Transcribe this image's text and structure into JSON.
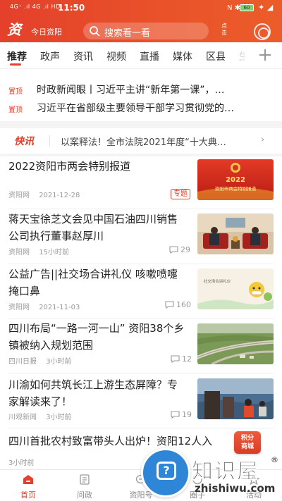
{
  "status_bar": {
    "signal": "4G⁺ .ıl 4G .ıl HD",
    "time": "11:50",
    "battery": "60",
    "status_icons": "N ✱ ⏰",
    "extra": "✦ ◢"
  },
  "header": {
    "logo_glyph": "资",
    "app_title": "今日资阳",
    "search_placeholder": "搜索看一看",
    "points_label_top": "点",
    "points_label_bottom": "击",
    "avatar_icon": "user-avatar-icon"
  },
  "tabs": {
    "items": [
      "推荐",
      "政声",
      "资讯",
      "视频",
      "直播",
      "媒体",
      "区县",
      "生"
    ],
    "active": "推荐",
    "add_icon": "plus-icon"
  },
  "pinned": [
    {
      "badge": "置顶",
      "title": "时政新闻眼丨习近平主讲“新年第一课”，…"
    },
    {
      "badge": "置顶",
      "title": "习近平在省部级主要领导干部学习贯彻党的…"
    }
  ],
  "flash": {
    "badge": "快讯",
    "text": "以案释法！全市法院2021年度“十大典…",
    "arrow": "›"
  },
  "news": [
    {
      "title": "2022资阳市两会特别报道",
      "source": "资阳网",
      "time": "2021-12-28",
      "tag": "专题",
      "comments": "",
      "thumb_text": "2022 资阳市两会特别报道"
    },
    {
      "title": "蒋天宝徐芝文会见中国石油四川销售公司执行董事赵厚川",
      "source": "资阳网",
      "time": "15小时前",
      "tag": "",
      "comments": "29",
      "thumb_text": ""
    },
    {
      "title": "公益广告||社交场合讲礼仪 咳嗽喷嚏掩口鼻",
      "source": "资阳网",
      "time": "2021-11-03",
      "tag": "",
      "comments": "160",
      "thumb_text": "社交场合讲礼仪"
    },
    {
      "title": "四川布局“一路一河一山” 资阳38个乡镇被纳入规划范围",
      "source": "四川日报",
      "time": "3小时前",
      "tag": "",
      "comments": "12",
      "thumb_text": ""
    },
    {
      "title": "川渝如何共筑长江上游生态屏障？专家解读来了！",
      "source": "川观新闻",
      "time": "3小时前",
      "tag": "",
      "comments": "19",
      "thumb_text": ""
    },
    {
      "title": "四川首批农村致富带头人出炉！资阳12人入",
      "source": "",
      "time": "3小时前",
      "tag": "",
      "comments": "",
      "thumb_text": ""
    }
  ],
  "bottom_nav": [
    {
      "label": "首页",
      "icon": "home-icon",
      "active": true
    },
    {
      "label": "问政",
      "icon": "question-doc-icon",
      "active": false
    },
    {
      "label": "资阳号",
      "icon": "chat-icon",
      "active": false
    },
    {
      "label": "圈子",
      "icon": "circle-icon",
      "active": false
    },
    {
      "label": "活动",
      "icon": "activity-icon",
      "active": false
    }
  ],
  "floating_badge": {
    "line1": "积分",
    "line2": "商城"
  },
  "watermark": {
    "name": "知识屋",
    "reg": "®",
    "url": "zhishiwu.com",
    "glyph": "?"
  },
  "colors": {
    "brand_red": "#e4402b",
    "watermark_blue": "#2f86d6"
  }
}
